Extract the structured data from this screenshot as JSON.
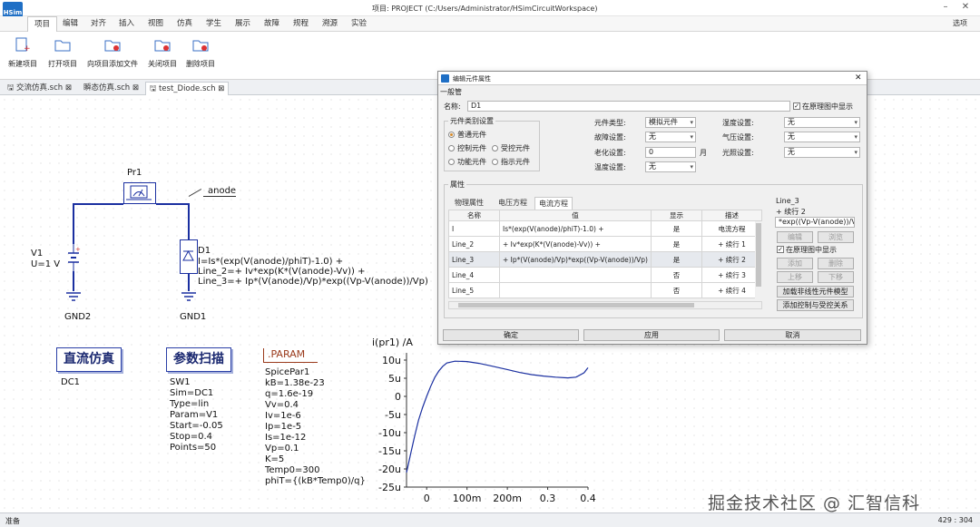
{
  "window": {
    "title": "项目: PROJECT (C:/Users/Administrator/HSimCircuitWorkspace)",
    "logo": "HSim"
  },
  "menu": {
    "tabs": [
      "项目",
      "编辑",
      "对齐",
      "插入",
      "视图",
      "仿真",
      "学生",
      "展示",
      "故障",
      "规程",
      "溯源",
      "实验"
    ],
    "theme_label": "选项"
  },
  "ribbon": {
    "buttons": [
      {
        "label": "新建项目",
        "icon": "new-project-icon"
      },
      {
        "label": "打开项目",
        "icon": "open-folder-icon"
      },
      {
        "label": "向项目添加文件",
        "icon": "add-file-icon"
      },
      {
        "label": "关闭项目",
        "icon": "close-project-icon"
      },
      {
        "label": "删除项目",
        "icon": "delete-project-icon"
      }
    ]
  },
  "doc_tabs": [
    "交流仿真.sch",
    "瞬态仿真.sch",
    "test_Diode.sch"
  ],
  "schematic": {
    "probe": "Pr1",
    "net_label": "anode",
    "v1_name": "V1",
    "v1_value": "U=1 V",
    "d1_name": "D1",
    "d1_lines": [
      "I=Is*(exp(V(anode)/phiT)-1.0) +",
      "Line_2=+ Iv*exp(K*(V(anode)-Vv)) +",
      "Line_3=+ Ip*(V(anode)/Vp)*exp((Vp-V(anode))/Vp)"
    ],
    "gnd2": "GND2",
    "gnd1": "GND1",
    "dc_block": "直流仿真",
    "dc_name": "DC1",
    "sweep_block": "参数扫描",
    "sweep_lines": [
      "SW1",
      "Sim=DC1",
      "Type=lin",
      "Param=V1",
      "Start=-0.05",
      "Stop=0.4",
      "Points=50"
    ],
    "param_block": ".PARAM",
    "param_lines": [
      "SpicePar1",
      "kB=1.38e-23",
      "q=1.6e-19",
      "Vv=0.4",
      "Iv=1e-6",
      "Ip=1e-5",
      "Is=1e-12",
      "Vp=0.1",
      "K=5",
      "Temp0=300",
      "phiT={(kB*Temp0)/q}"
    ]
  },
  "chart_data": {
    "type": "line",
    "title": "",
    "ylabel": "i(pr1) /A",
    "xlabel": "",
    "x_ticks": [
      "0",
      "100m",
      "200m",
      "0.3",
      "0.4"
    ],
    "y_ticks": [
      "10u",
      "5u",
      "0",
      "-5u",
      "-10u",
      "-15u",
      "-20u",
      "-25u"
    ],
    "xlim": [
      -0.05,
      0.4
    ],
    "ylim": [
      -25,
      12
    ],
    "y_unit_note": "u",
    "grid": false,
    "series": [
      {
        "x": [
          -0.05,
          -0.04,
          -0.03,
          -0.02,
          -0.01,
          0,
          0.01,
          0.02,
          0.03,
          0.04,
          0.05,
          0.07,
          0.1,
          0.13,
          0.16,
          0.2,
          0.23,
          0.26,
          0.29,
          0.32,
          0.35,
          0.37,
          0.39,
          0.4
        ],
        "y": [
          -21,
          -16,
          -11,
          -6.5,
          -3,
          0,
          2.8,
          5.2,
          7,
          8.3,
          9.2,
          9.7,
          9.6,
          9.1,
          8.4,
          7.4,
          6.6,
          6.0,
          5.6,
          5.3,
          5.1,
          5.3,
          6.5,
          7.9
        ],
        "color": "#1a2fa0"
      }
    ]
  },
  "status": {
    "left": "准备",
    "right": "429 : 304"
  },
  "watermark": "掘金技术社区 @ 汇智信科",
  "dialog": {
    "title": "编辑元件属性",
    "section_general": "一般管",
    "name_label": "名称:",
    "name_value": "D1",
    "show_in_schematic": "在原理图中显示",
    "category_group": "元件类别设置",
    "radios": [
      "普通元件",
      "控制元件",
      "受控元件",
      "功能元件",
      "指示元件"
    ],
    "component_type_label": "元件类型:",
    "component_type_value": "模拟元件",
    "fault_label": "故障设置:",
    "fault_value": "无",
    "aging_label": "老化设置:",
    "aging_value": "0",
    "aging_unit": "月",
    "temp_label": "温度设置:",
    "temp_value": "无",
    "humidity_label": "湿度设置:",
    "humidity_value": "无",
    "pressure_label": "气压设置:",
    "pressure_value": "无",
    "light_label": "光照设置:",
    "light_value": "无",
    "props_group": "属性",
    "subtabs": [
      "物理属性",
      "电压方程",
      "电流方程"
    ],
    "table_headers": [
      "名称",
      "值",
      "显示",
      "描述"
    ],
    "rows": [
      {
        "name": "I",
        "value": "Is*(exp(V(anode)/phiT)-1.0) +",
        "show": "是",
        "desc": "电流方程"
      },
      {
        "name": "Line_2",
        "value": "+ Iv*exp(K*(V(anode)-Vv)) +",
        "show": "是",
        "desc": "+ 续行 1"
      },
      {
        "name": "Line_3",
        "value": "+ Ip*(V(anode)/Vp)*exp((Vp-V(anode))/Vp)",
        "show": "是",
        "desc": "+ 续行 2"
      },
      {
        "name": "Line_4",
        "value": "",
        "show": "否",
        "desc": "+ 续行 3"
      },
      {
        "name": "Line_5",
        "value": "",
        "show": "否",
        "desc": "+ 续行 4"
      }
    ],
    "side_name": "Line_3",
    "side_desc": "+ 续行 2",
    "side_value": "*exp((Vp-V(anode))/Vp)",
    "btn_edit": "编辑",
    "btn_browse": "浏览",
    "side_show": "在原理图中显示",
    "btn_add": "添加",
    "btn_delete": "删除",
    "btn_up": "上移",
    "btn_down": "下移",
    "btn_load_model": "加载非线性元件模型",
    "btn_add_control": "添加控制与受控关系",
    "btn_ok": "确定",
    "btn_apply": "应用",
    "btn_cancel": "取消"
  }
}
